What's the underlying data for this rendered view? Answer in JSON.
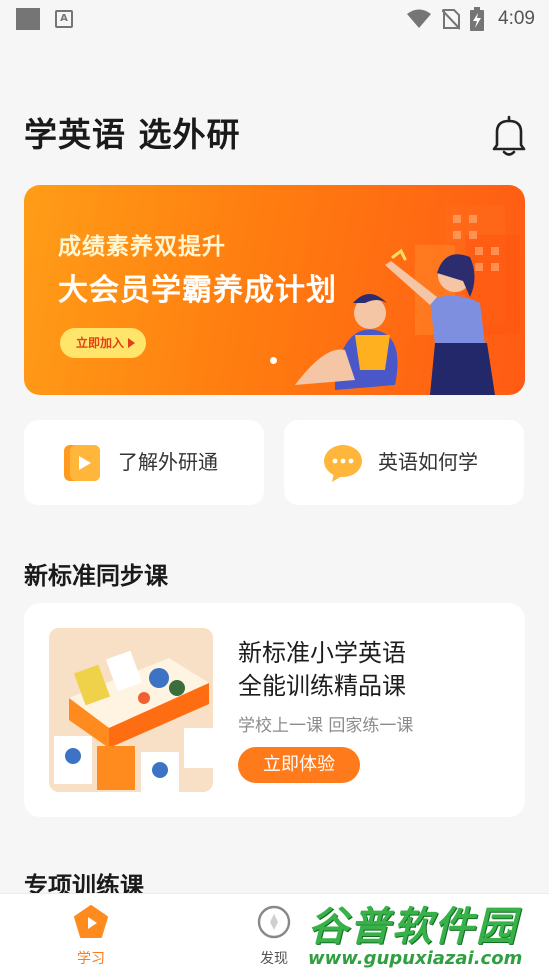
{
  "status_bar": {
    "time": "4:09",
    "app_badge": "A"
  },
  "header": {
    "title": "学英语 选外研"
  },
  "banner": {
    "subtitle": "成绩素养双提升",
    "title": "大会员学霸养成计划",
    "button_label": "立即加入"
  },
  "quick_links": [
    {
      "label": "了解外研通",
      "icon": "play-icon"
    },
    {
      "label": "英语如何学",
      "icon": "chat-bubble-icon"
    }
  ],
  "sections": {
    "sync_course": "新标准同步课",
    "special_training": "专项训练课"
  },
  "course": {
    "title_line1": "新标准小学英语",
    "title_line2": "全能训练精品课",
    "subtitle": "学校上一课 回家练一课",
    "button_label": "立即体验"
  },
  "tabs": [
    {
      "label": "学习",
      "active": true
    },
    {
      "label": "发现",
      "active": false
    }
  ],
  "watermark": {
    "text": "谷普软件园",
    "url": "www.gupuxiazai.com"
  },
  "colors": {
    "accent": "#ff7a1a",
    "tab_active": "#ff7a1a",
    "tab_inactive": "#555555"
  }
}
